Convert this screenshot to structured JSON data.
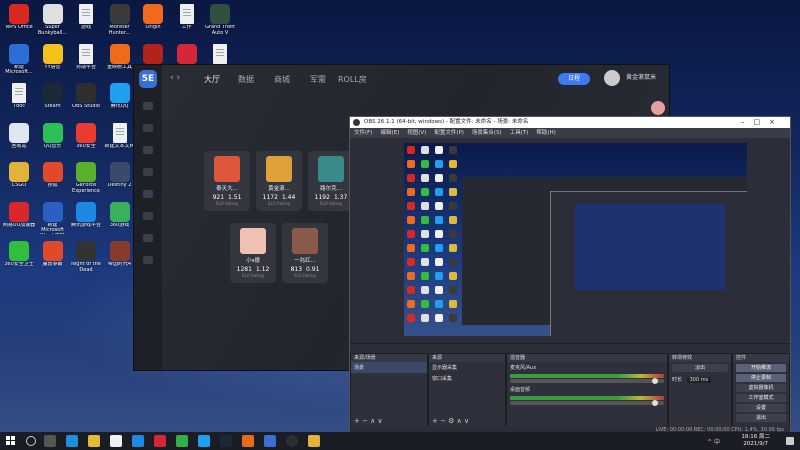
{
  "desktop": {
    "icons": [
      {
        "label": "WPS Office",
        "color": "#d8281f"
      },
      {
        "label": "Super Bunkyball...",
        "color": "#e0e0e0"
      },
      {
        "label": "游戏",
        "color": "#f0f0f0"
      },
      {
        "label": "Monster Hunter...",
        "color": "#3a3a3a"
      },
      {
        "label": "Origin",
        "color": "#f06a1c"
      },
      {
        "label": "工作",
        "color": "#f0f0f0"
      },
      {
        "label": "Grand Theft Auto V",
        "color": "#2f4f3f"
      },
      {
        "label": "新建 Microsoft...",
        "color": "#2b6fd6"
      },
      {
        "label": "YY语音",
        "color": "#f2c21b"
      },
      {
        "label": "对战平台",
        "color": "#f0f0f0"
      },
      {
        "label": "重映射工具",
        "color": "#f06a1c"
      },
      {
        "label": "Dota 2",
        "color": "#b0241c"
      },
      {
        "label": "网易云音乐",
        "color": "#d6263a"
      },
      {
        "label": "温馨工程资...",
        "color": "#f0f0f0"
      },
      {
        "label": "Tdoc",
        "color": "#f0f0f0"
      },
      {
        "label": "Steam",
        "color": "#1b2838"
      },
      {
        "label": "OBS Studio",
        "color": "#2e2e2e"
      },
      {
        "label": "腾讯QQ",
        "color": "#1ea0f0"
      },
      {
        "label": "Microsoft Edge",
        "color": "#1c8fd8"
      },
      {
        "label": "火绒安全",
        "color": "#e05a22"
      },
      {
        "label": "斗鱼",
        "color": "#e86a1a"
      },
      {
        "label": "回收站",
        "color": "#dfe6ee"
      },
      {
        "label": "QQ音乐",
        "color": "#2fbf5a"
      },
      {
        "label": "360安全",
        "color": "#ea3b2f"
      },
      {
        "label": "新建文本文档",
        "color": "#f0f0f0"
      },
      {
        "label": "Downloads",
        "color": "#e3b93a"
      },
      {
        "label": "腾讯视频",
        "color": "#f2a33a"
      },
      {
        "label": "360浏览器",
        "color": "#2fb04a"
      },
      {
        "label": "CSGO",
        "color": "#e2b33a"
      },
      {
        "label": "搜狐",
        "color": "#e04a2a"
      },
      {
        "label": "GeForce Experience",
        "color": "#5ab02a"
      },
      {
        "label": "Destiny 2",
        "color": "#3a4a6a"
      },
      {
        "label": "WeGame",
        "color": "#2a5ad6"
      },
      {
        "label": "工具",
        "color": "#f0f0f0"
      },
      {
        "label": "腾讯软件",
        "color": "#3a8ad6"
      },
      {
        "label": "网易UU加速器",
        "color": "#d8282a"
      },
      {
        "label": "新建 Microsoft Word 文档",
        "color": "#2b5fc6"
      },
      {
        "label": "腾讯游戏平台",
        "color": "#1e88e5"
      },
      {
        "label": "360游戏",
        "color": "#3ab05a"
      },
      {
        "label": "2021",
        "color": "#f0f0f0"
      },
      {
        "label": "文档",
        "color": "#f0f0f0"
      },
      {
        "label": "微信",
        "color": "#2fbf3a"
      },
      {
        "label": "360安全卫士",
        "color": "#2fbf3a"
      },
      {
        "label": "魔兽争霸",
        "color": "#e04a2a"
      },
      {
        "label": "Night of the Dead",
        "color": "#333333"
      },
      {
        "label": "帝国时代4",
        "color": "#8a3a2a"
      },
      {
        "label": "完美平台",
        "color": "#1e3a6a"
      }
    ]
  },
  "game_client": {
    "nav": [
      "大厅",
      "数据",
      "商城",
      "军需",
      "ROLL房"
    ],
    "promo_label": "日程",
    "username": "黄金滚鼠米",
    "players": [
      {
        "name": "泰天大...",
        "elo": "921",
        "rating": "1.51",
        "color": "#e0563a"
      },
      {
        "name": "黄金滚...",
        "elo": "1172",
        "rating": "1.44",
        "color": "#e0a03a"
      },
      {
        "name": "路尔克...",
        "elo": "1192",
        "rating": "1.37",
        "color": "#3a8a8a"
      },
      {
        "name": "小s德",
        "elo": "1281",
        "rating": "1.12",
        "color": "#f0c0b0"
      },
      {
        "name": "一兆红...",
        "elo": "813",
        "rating": "0.91",
        "color": "#8a5a4a"
      }
    ],
    "elo_label": "ELO",
    "rating_label": "Rating"
  },
  "obs": {
    "title": "OBS 26.1.1 (64-bit, windows) - 配置文件: 未命名 - 场景: 未命名",
    "menu": [
      "文件(F)",
      "编辑(E)",
      "视图(V)",
      "配置文件(P)",
      "场景集合(S)",
      "工具(T)",
      "帮助(H)"
    ],
    "docks": {
      "scenes": {
        "title": "来源/场景",
        "items": [
          "场景"
        ]
      },
      "sources": {
        "title": "来源",
        "items": [
          "显示器采集",
          "窗口采集"
        ]
      },
      "mixer": {
        "title": "混音器",
        "channels": [
          {
            "name": "麦克风/Aux",
            "db": "0.0 dB"
          },
          {
            "name": "桌面音频",
            "db": "0.0 dB"
          }
        ]
      },
      "transitions": {
        "title": "转场特效",
        "type": "淡出",
        "duration_label": "时长",
        "duration": "300 ms"
      },
      "controls": {
        "title": "控件",
        "buttons": [
          "开始推流",
          "停止录制",
          "虚拟摄像机",
          "工作室模式",
          "设置",
          "退出"
        ]
      }
    },
    "status": "LIVE: 00:00:00   REC: 00:00:00   CPU: 1.4%, 30.00 fps"
  },
  "taskbar": {
    "time": "18:16 周二",
    "date": "2021/9/7",
    "tray": "^ 中"
  }
}
